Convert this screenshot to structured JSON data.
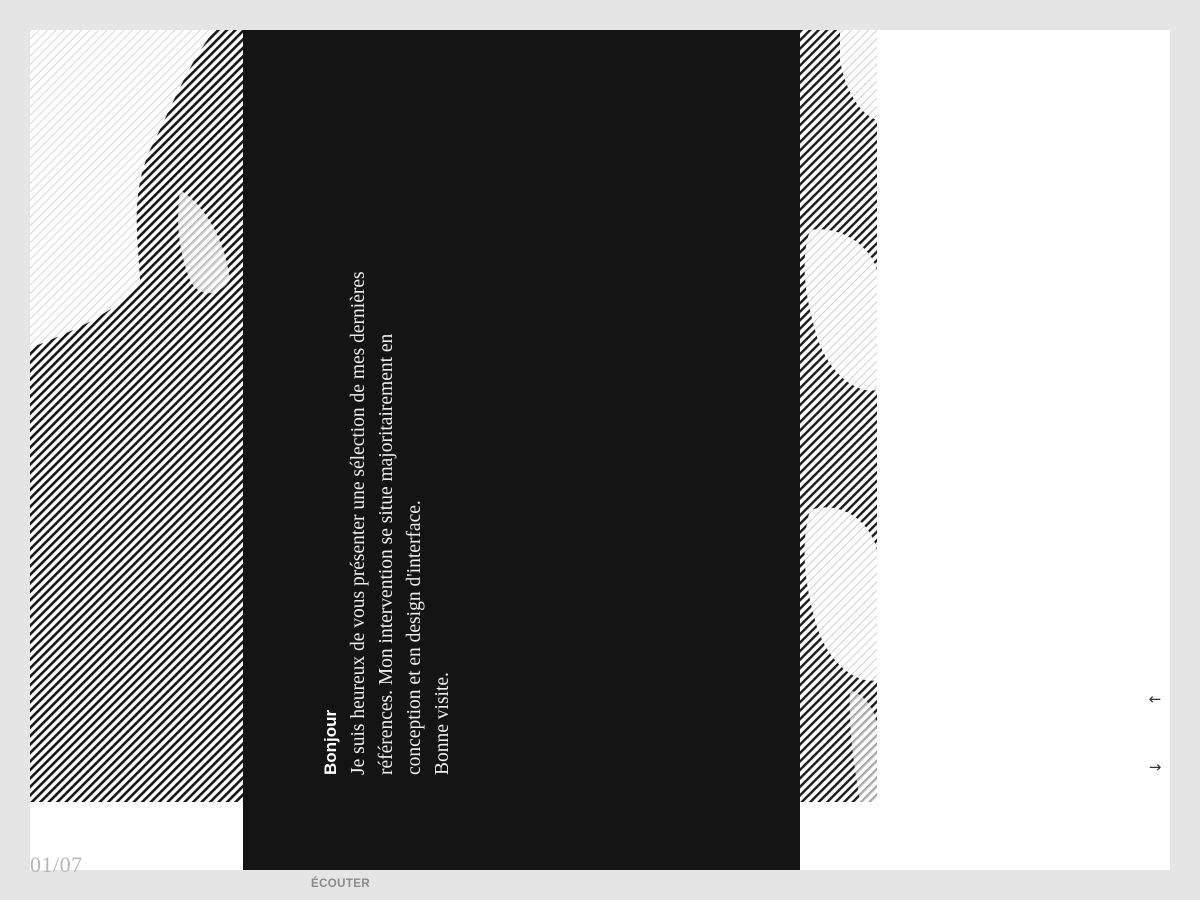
{
  "intro": {
    "greeting": "Bonjour",
    "lines": [
      "Je suis heureux de vous présenter une sélection de mes dernières",
      "références. Mon intervention se situe majoritairement en",
      "conception et en design d'interface.",
      "Bonne visite."
    ]
  },
  "pagination": {
    "counter": "01/07"
  },
  "controls": {
    "listen_label": "ÉCOUTER",
    "prev_arrow": "←",
    "next_arrow": "→"
  },
  "colors": {
    "page_background": "#e5e5e5",
    "panel_background": "#141414",
    "hatch": "#1a1a1a"
  }
}
